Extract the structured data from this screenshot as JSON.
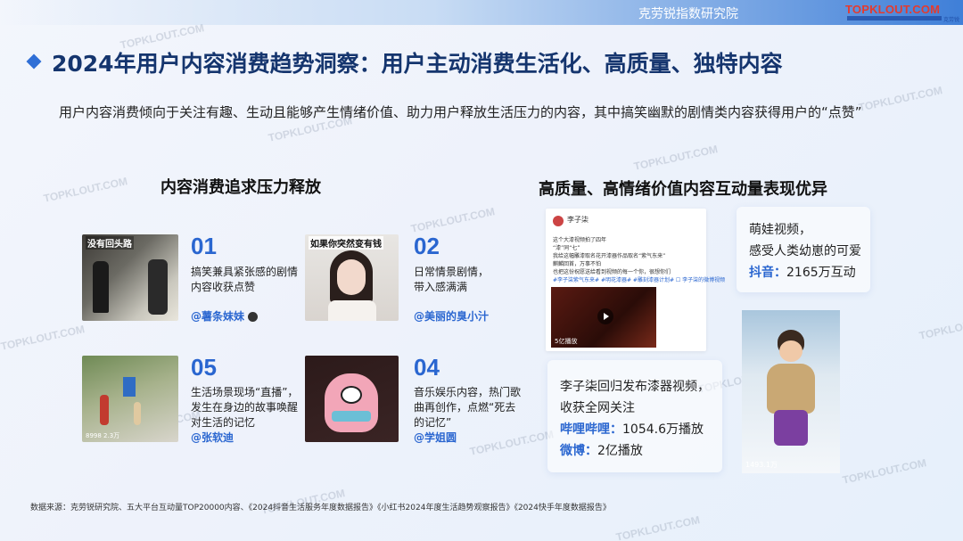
{
  "header": {
    "institute": "克劳锐指数研究院",
    "logo_text": "TOPKLOUT.COM",
    "logo_cn": "克劳锐"
  },
  "title": "2024年用户内容消费趋势洞察：用户主动消费生活化、高质量、独特内容",
  "description": "用户内容消费倾向于关注有趣、生动且能够产生情绪价值、助力用户释放生活压力的内容，其中搞笑幽默的剧情类内容获得用户的“点赞”",
  "left_section": {
    "heading": "内容消费追求压力释放",
    "items": [
      {
        "num": "01",
        "lines": [
          "搞笑兼具紧张感的剧情",
          "内容收获点赞"
        ],
        "handle": "@薯条妹妹",
        "thumb_caption": "没有回头路"
      },
      {
        "num": "02",
        "lines": [
          "日常情景剧情，",
          "带入感满满"
        ],
        "handle": "@美丽的臭小汁",
        "thumb_caption": "如果你突然变有钱"
      },
      {
        "num": "05",
        "lines": [
          "生活场景现场“直播”，",
          "发生在身边的故事唤醒",
          "对生活的记忆"
        ],
        "handle": "@张软迪",
        "thumb_foot": "8998 2.3万"
      },
      {
        "num": "04",
        "lines": [
          "音乐娱乐内容，热门歌",
          "曲再创作，点燃“死去",
          "的记忆”"
        ],
        "handle": "@学姐圆"
      }
    ]
  },
  "right_section": {
    "heading": "高质量、高情绪价值内容互动量表现优异",
    "post": {
      "name": "李子柒",
      "lines": [
        "这个大漆视频拍了四年",
        "“漆”同“七”",
        "我给这幅雕漆取名花开漆器作品取名“紫气东来”",
        "麒麟回首，万事不怕",
        "也把这份祝愿送给看到视频的每一个你，很想你们",
        "#李子柒紫气东来# #明花漆器# #雕刻漆器计划# ☐ 李子柒的微博视频"
      ],
      "video_foot": "5亿播放"
    },
    "card_lizi": {
      "line1": "李子柒回归发布漆器视频，",
      "line2": "收获全网关注",
      "bili_label": "哔哩哔哩：",
      "bili_value": "1054.6万播放",
      "weibo_label": "微博：",
      "weibo_value": "2亿播放"
    },
    "card_baby": {
      "line1": "萌娃视频，",
      "line2": "感受人类幼崽的可爱",
      "douyin_label": "抖音：",
      "douyin_value": "2165万互动"
    },
    "baby_foot": "1493.1万"
  },
  "source": "数据来源：克劳锐研究院、五大平台互动量TOP20000内容、《2024抖音生活服务年度数据报告》《小红书2024年度生活趋势观察报告》《2024快手年度数据报告》",
  "watermark": "TOPKLOUT.COM",
  "colors": {
    "accent": "#2a66d0",
    "title": "#15356e",
    "logo_red": "#e53b2e"
  }
}
